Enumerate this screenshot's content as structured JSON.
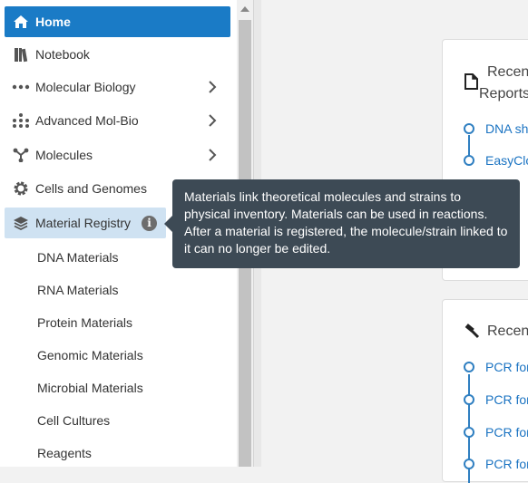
{
  "sidebar": {
    "nav_items": [
      {
        "label": "Home",
        "icon": "home-icon"
      },
      {
        "label": "Notebook",
        "icon": "notebook-icon"
      },
      {
        "label": "Molecular Biology",
        "icon": "dots-icon"
      },
      {
        "label": "Advanced Mol-Bio",
        "icon": "grid-dots-icon"
      },
      {
        "label": "Molecules",
        "icon": "branch-icon"
      },
      {
        "label": "Cells and Genomes",
        "icon": "gear-icon"
      },
      {
        "label": "Material Registry",
        "icon": "layers-icon"
      }
    ],
    "info_glyph": "i",
    "sub_items": [
      {
        "label": "DNA Materials"
      },
      {
        "label": "RNA Materials"
      },
      {
        "label": "Protein Materials"
      },
      {
        "label": "Genomic Materials"
      },
      {
        "label": "Microbial Materials"
      },
      {
        "label": "Cell Cultures"
      },
      {
        "label": "Reagents"
      }
    ]
  },
  "tooltip": {
    "text": "Materials link theoretical molecules and strains to physical inventory. Materials can be used in reactions. After a material is registered, the molecule/strain linked to it can no longer be edited."
  },
  "panels": [
    {
      "title_line1": "Recen",
      "title_line2": "Reports",
      "icon": "document-icon",
      "links": [
        "DNA sh",
        "EasyClo"
      ]
    },
    {
      "title_line1": "Recen",
      "icon": "hammer-icon",
      "links": [
        "PCR for",
        "PCR for",
        "PCR for",
        "PCR for"
      ]
    }
  ],
  "colors": {
    "accent": "#1a7bc6",
    "highlight": "#cfe2f2",
    "tooltip_bg": "#3d4a55",
    "link": "#1a73c2"
  }
}
